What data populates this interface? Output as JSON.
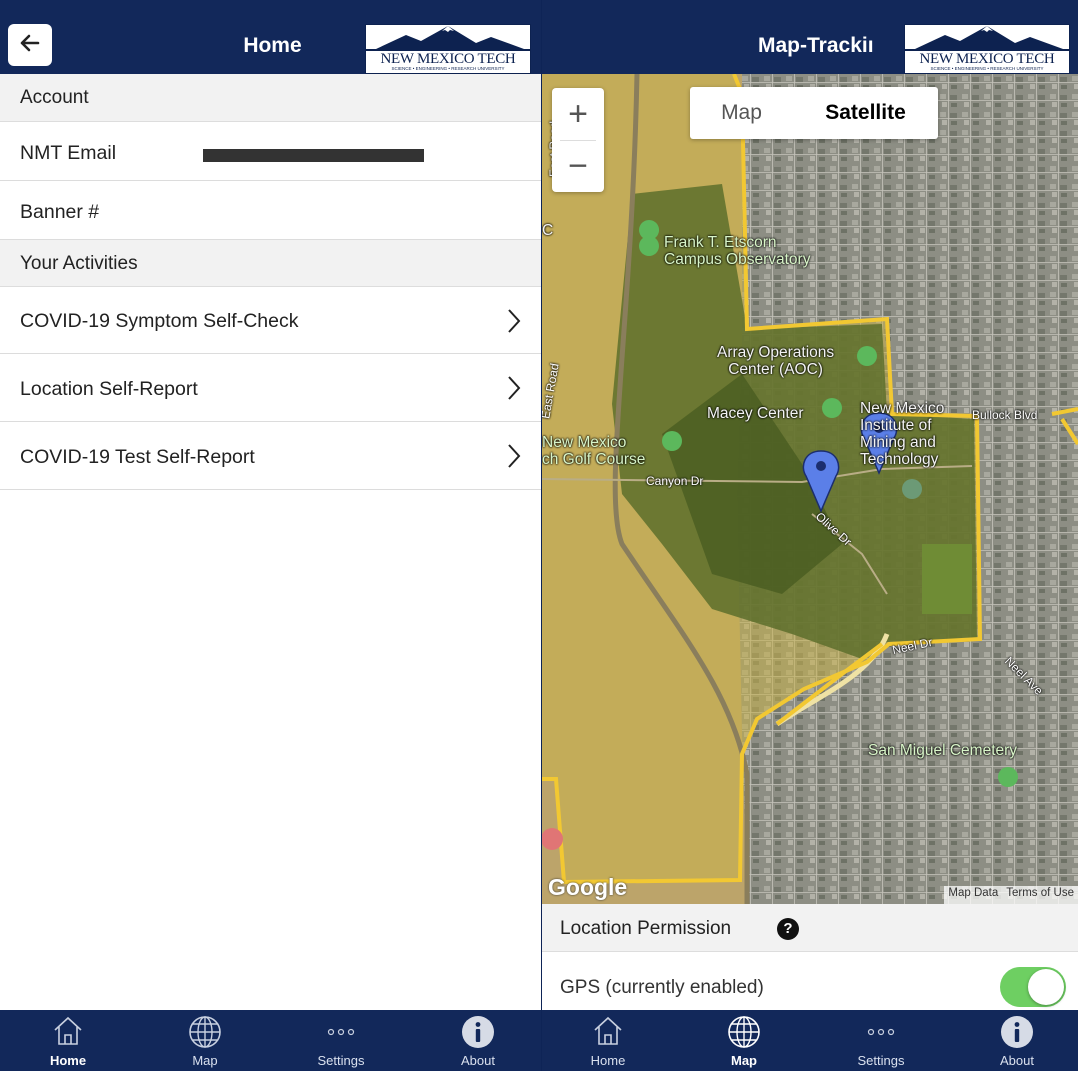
{
  "home": {
    "title": "Home",
    "logo": {
      "name": "NEW MEXICO TECH",
      "tagline": "SCIENCE • ENGINEERING • RESEARCH UNIVERSITY"
    },
    "account_header": "Account",
    "email_label": "NMT Email",
    "banner_label": "Banner #",
    "activities_header": "Your Activities",
    "activities": [
      {
        "label": "COVID-19 Symptom Self-Check"
      },
      {
        "label": "Location Self-Report"
      },
      {
        "label": "COVID-19 Test Self-Report"
      }
    ]
  },
  "maptrack": {
    "title": "Map-Trackiı",
    "logo": {
      "name": "NEW MEXICO TECH",
      "tagline": "SCIENCE • ENGINEERING • RESEARCH UNIVERSITY"
    },
    "map_types": {
      "map": "Map",
      "satellite": "Satellite",
      "selected": "Satellite"
    },
    "zoom_in": "+",
    "zoom_out": "−",
    "labels": {
      "observatory": "Frank T. Etscorn\nCampus Observatory",
      "aoc": "Array Operations\nCenter (AOC)",
      "macey": "Macey Center",
      "institute": "New Mexico\nInstitute of\nMining and\nTechnology",
      "golf": "New Mexico\nch Golf Course",
      "cemetery": "San Miguel Cemetery",
      "canyon": "Canyon Dr",
      "olive": "Olive Dr",
      "bullock": "Bullock Blvd",
      "neel": "Neel Ave",
      "east_road": "East Road",
      "east_road2": "East Road",
      "road_c": "C",
      "neel2": "Neel Dr"
    },
    "google": "Google",
    "map_data": "Map Data",
    "terms": "Terms of Use",
    "permission_header": "Location Permission",
    "help": "?",
    "gps_label": "GPS (currently enabled)",
    "gps_enabled": true
  },
  "tabs": [
    {
      "label": "Home",
      "icon": "home-icon"
    },
    {
      "label": "Map",
      "icon": "globe-icon"
    },
    {
      "label": "Settings",
      "icon": "more-icon"
    },
    {
      "label": "About",
      "icon": "info-icon"
    }
  ],
  "left_active_tab": "Home",
  "right_active_tab": "Map",
  "colors": {
    "navy": "#12285a",
    "toggle_on": "#6ecf62",
    "boundary": "#f2c832",
    "pin": "#5b7fe8"
  }
}
